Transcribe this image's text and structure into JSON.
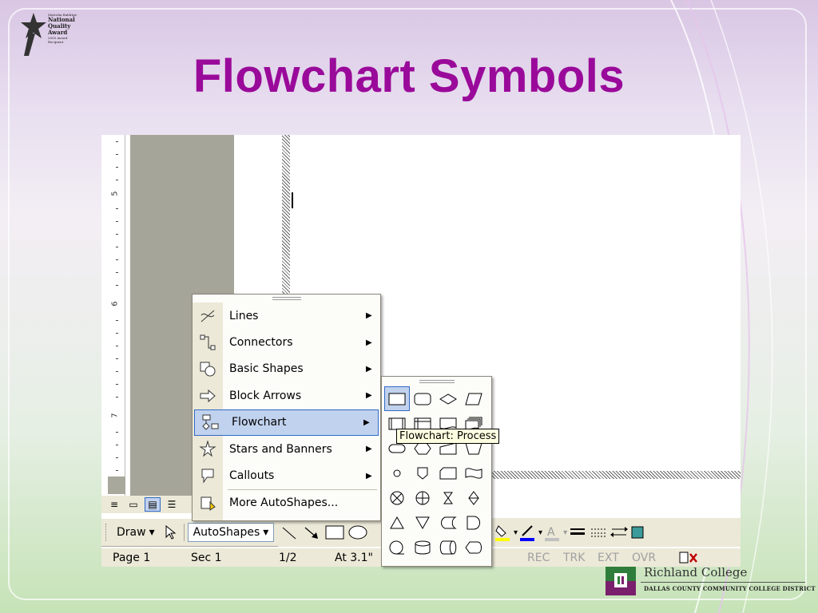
{
  "slide": {
    "title": "Flowchart Symbols"
  },
  "award_logo": {
    "lines": [
      "National",
      "Quality",
      "Award"
    ],
    "small_top": "Malcolm Baldrige",
    "small_bottom": "2005 Award Recipient"
  },
  "ruler": {
    "numbers": [
      "5",
      "6",
      "7"
    ]
  },
  "autoshapes_menu": {
    "items": [
      {
        "label": "Lines",
        "icon": "lines-icon",
        "has_submenu": true
      },
      {
        "label": "Connectors",
        "icon": "connectors-icon",
        "has_submenu": true
      },
      {
        "label": "Basic Shapes",
        "icon": "basic-shapes-icon",
        "has_submenu": true
      },
      {
        "label": "Block Arrows",
        "icon": "block-arrows-icon",
        "has_submenu": true
      },
      {
        "label": "Flowchart",
        "icon": "flowchart-icon",
        "has_submenu": true,
        "selected": true
      },
      {
        "label": "Stars and Banners",
        "icon": "stars-banners-icon",
        "has_submenu": true
      },
      {
        "label": "Callouts",
        "icon": "callouts-icon",
        "has_submenu": true
      },
      {
        "label": "More AutoShapes...",
        "icon": "more-autoshapes-icon",
        "has_submenu": false
      }
    ]
  },
  "flowchart_submenu": {
    "selected_shape": "Process",
    "tooltip": "Flowchart: Process"
  },
  "draw_toolbar": {
    "draw_label": "Draw",
    "autoshapes_label": "AutoShapes"
  },
  "status_bar": {
    "page": "Page 1",
    "section": "Sec 1",
    "page_of": "1/2",
    "at": "At 3.1\"",
    "rec": "REC",
    "trk": "TRK",
    "ext": "EXT",
    "ovr": "OVR"
  },
  "college": {
    "name": "Richland College",
    "district": "DALLAS COUNTY COMMUNITY COLLEGE DISTRICT"
  },
  "colors": {
    "title": "#9a0a9a",
    "menu_highlight": "#c1d2ee",
    "menu_highlight_border": "#316ac5",
    "toolbar_bg": "#ece9d8"
  }
}
